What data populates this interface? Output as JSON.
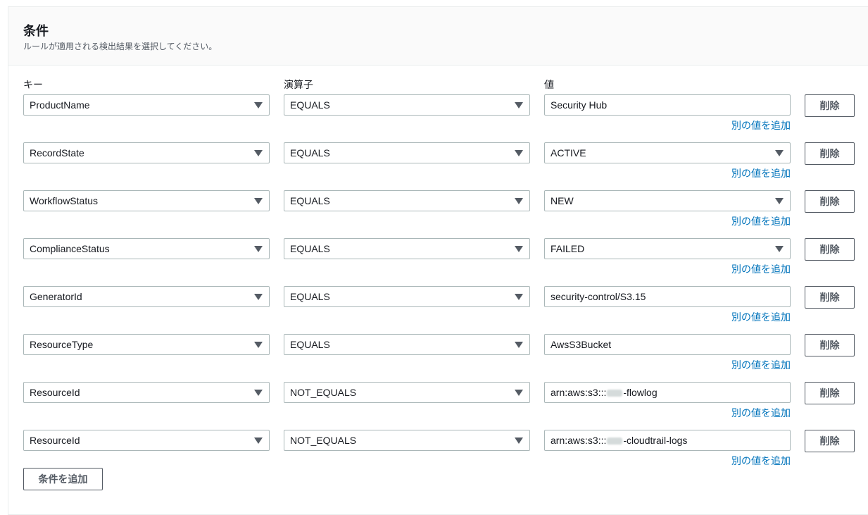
{
  "section": {
    "title": "条件",
    "description": "ルールが適用される検出結果を選択してください。"
  },
  "columns": {
    "key": "キー",
    "operator": "演算子",
    "value": "値"
  },
  "labels": {
    "delete": "削除",
    "add_value": "別の値を追加",
    "add_condition": "条件を追加"
  },
  "conditions": [
    {
      "key": "ProductName",
      "operator": "EQUALS",
      "value": "Security Hub",
      "value_is_dropdown": false
    },
    {
      "key": "RecordState",
      "operator": "EQUALS",
      "value": "ACTIVE",
      "value_is_dropdown": true
    },
    {
      "key": "WorkflowStatus",
      "operator": "EQUALS",
      "value": "NEW",
      "value_is_dropdown": true
    },
    {
      "key": "ComplianceStatus",
      "operator": "EQUALS",
      "value": "FAILED",
      "value_is_dropdown": true
    },
    {
      "key": "GeneratorId",
      "operator": "EQUALS",
      "value": "security-control/S3.15",
      "value_is_dropdown": false
    },
    {
      "key": "ResourceType",
      "operator": "EQUALS",
      "value": "AwsS3Bucket",
      "value_is_dropdown": false
    },
    {
      "key": "ResourceId",
      "operator": "NOT_EQUALS",
      "value_prefix": "arn:aws:s3:::",
      "value_suffix": "-flowlog",
      "value_is_dropdown": false,
      "value_redacted": true
    },
    {
      "key": "ResourceId",
      "operator": "NOT_EQUALS",
      "value_prefix": "arn:aws:s3:::",
      "value_suffix": "-cloudtrail-logs",
      "value_is_dropdown": false,
      "value_redacted": true
    }
  ],
  "colors": {
    "link": "#0073bb",
    "border": "#aab7b8",
    "header_bg": "#fafafa"
  }
}
